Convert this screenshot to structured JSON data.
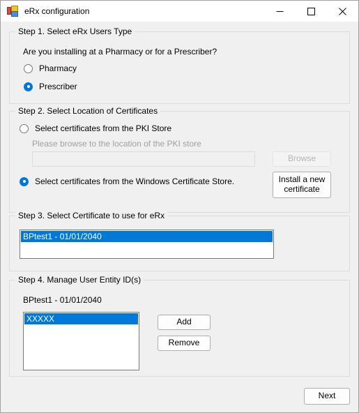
{
  "window": {
    "title": "eRx configuration",
    "icon": "application-window-icon",
    "controls": [
      {
        "name": "minimize-button",
        "glyph": "minimize-icon"
      },
      {
        "name": "maximize-button",
        "glyph": "maximize-icon"
      },
      {
        "name": "close-button",
        "glyph": "close-icon"
      }
    ]
  },
  "colors": {
    "accent": "#0078D7",
    "window_background": "#F0F0F0",
    "titlebar_background": "#FFFFFF",
    "groupbox_border": "#DCDCDC",
    "listbox_border": "#7A7A7A",
    "disabled_text": "#A0A0A0"
  },
  "step1": {
    "legend": "Step 1.  Select eRx Users Type",
    "question": "Are you installing at a Pharmacy or for a Prescriber?",
    "options": [
      {
        "label": "Pharmacy",
        "checked": false
      },
      {
        "label": "Prescriber",
        "checked": true
      }
    ]
  },
  "step2": {
    "legend": "Step 2. Select Location of Certificates",
    "pki_option": {
      "label": "Select certificates from the PKI Store",
      "checked": false
    },
    "pki_hint": "Please browse to the location of the PKI store",
    "pki_path_value": "",
    "pki_path_placeholder": "",
    "browse_button": {
      "label": "Browse",
      "enabled": false
    },
    "windows_store_option": {
      "label": "Select certificates from the Windows Certificate Store.",
      "checked": true
    },
    "install_button": {
      "line1": "Install a new",
      "line2": "certificate",
      "enabled": true
    }
  },
  "step3": {
    "legend": "Step 3. Select Certificate to use for eRx",
    "items": [
      {
        "label": "BPtest1 - 01/01/2040",
        "selected": true
      }
    ]
  },
  "step4": {
    "legend": "Step 4. Manage User Entity ID(s)",
    "certificate_label": "BPtest1 - 01/01/2040",
    "items": [
      {
        "label": "XXXXX",
        "selected": true
      }
    ],
    "add_button": "Add",
    "remove_button": "Remove"
  },
  "footer": {
    "next_button": "Next"
  }
}
